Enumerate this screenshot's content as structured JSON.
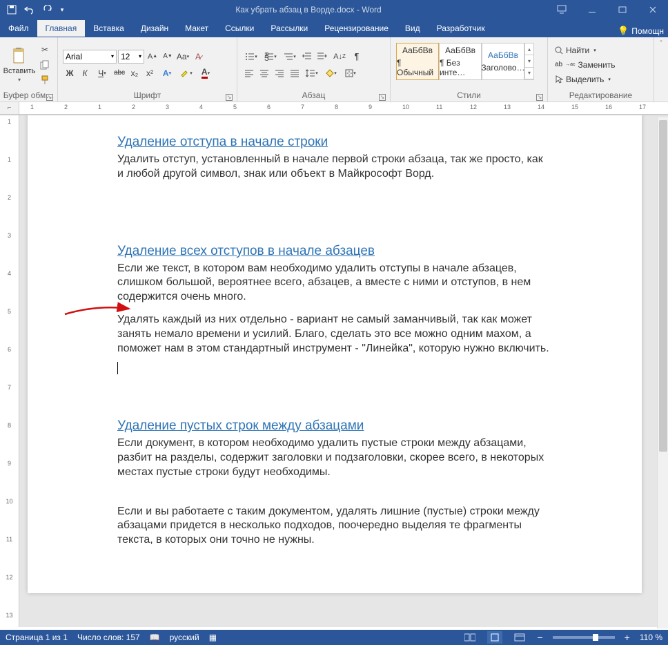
{
  "titlebar": {
    "title": "Как убрать абзац в Ворде.docx - Word"
  },
  "tabs": {
    "file": "Файл",
    "home": "Главная",
    "insert": "Вставка",
    "design": "Дизайн",
    "layout": "Макет",
    "references": "Ссылки",
    "mailings": "Рассылки",
    "review": "Рецензирование",
    "view": "Вид",
    "developer": "Разработчик",
    "help": "Помощн"
  },
  "ribbon": {
    "clipboard": {
      "label": "Буфер обм…",
      "paste": "Вставить"
    },
    "font": {
      "label": "Шрифт",
      "name": "Arial",
      "size": "12",
      "bold": "Ж",
      "italic": "К",
      "underline": "Ч",
      "strike": "abc",
      "sub": "x₂",
      "sup": "x²"
    },
    "paragraph": {
      "label": "Абзац"
    },
    "styles": {
      "label": "Стили",
      "items": [
        {
          "preview": "АаБбВв",
          "name": "¶ Обычный"
        },
        {
          "preview": "АаБбВв",
          "name": "¶ Без инте…"
        },
        {
          "preview": "АаБбВв",
          "name": "Заголово…"
        }
      ]
    },
    "editing": {
      "label": "Редактирование",
      "find": "Найти",
      "replace": "Заменить",
      "select": "Выделить"
    }
  },
  "ruler_h": [
    "1",
    "2",
    "1",
    "2",
    "3",
    "4",
    "5",
    "6",
    "7",
    "8",
    "9",
    "10",
    "11",
    "12",
    "13",
    "14",
    "15",
    "16",
    "17"
  ],
  "ruler_v": [
    "1",
    "1",
    "2",
    "3",
    "4",
    "5",
    "6",
    "7",
    "8",
    "9",
    "10",
    "11",
    "12",
    "13"
  ],
  "doc": {
    "h1": "Удаление отступа в начале строки",
    "p1": "Удалить отступ, установленный в начале первой строки абзаца, так же просто, как и любой другой символ, знак или объект в Майкрософт Ворд.",
    "h2": "Удаление всех отступов в начале абзацев",
    "p2": "Если же текст, в котором вам необходимо удалить отступы в начале абзацев, слишком большой, вероятнее всего, абзацев, а вместе с ними и отступов, в нем содержится очень много.",
    "p3": "Удалять каждый из них отдельно - вариант не самый заманчивый, так как может занять немало времени и усилий. Благо, сделать это все можно одним махом, а поможет нам в этом стандартный инструмент - \"Линейка\", которую нужно включить.",
    "h3": "Удаление пустых строк между абзацами",
    "p4": "Если документ, в котором необходимо удалить пустые строки между абзацами, разбит на разделы, содержит заголовки и подзаголовки, скорее всего, в некоторых местах пустые строки будут необходимы.",
    "p5": "Если и вы работаете с таким документом, удалять лишние (пустые) строки между абзацами придется в несколько подходов, поочередно выделяя те фрагменты текста, в которых они точно не нужны."
  },
  "status": {
    "page": "Страница 1 из 1",
    "words": "Число слов: 157",
    "lang": "русский",
    "zoom": "110 %"
  }
}
